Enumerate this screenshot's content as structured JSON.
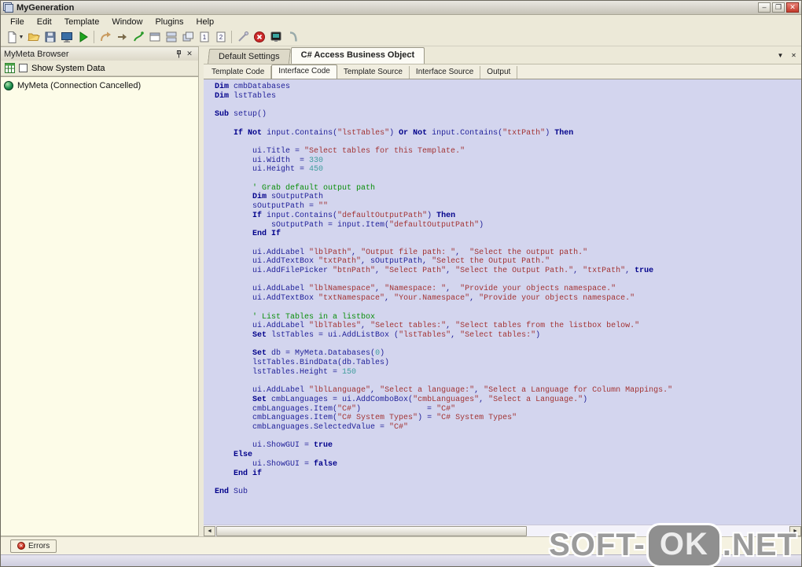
{
  "window": {
    "title": "MyGeneration",
    "controls": {
      "minimize": "–",
      "restore": "❐",
      "close": "✕"
    }
  },
  "menu": [
    "File",
    "Edit",
    "Template",
    "Window",
    "Plugins",
    "Help"
  ],
  "toolbar": [
    {
      "name": "new-template-button",
      "shape": "page-new",
      "dropdown": true
    },
    {
      "name": "open-button",
      "shape": "folder-open"
    },
    {
      "name": "save-button",
      "shape": "save"
    },
    {
      "name": "dos-console-button",
      "shape": "console-blue"
    },
    {
      "name": "execute-template-button",
      "shape": "play-green"
    },
    {
      "name": "separator",
      "shape": "sep"
    },
    {
      "name": "redo-arrow-button",
      "shape": "arrow-curve"
    },
    {
      "name": "forward-arrow-button",
      "shape": "arrow-small"
    },
    {
      "name": "run-script-button",
      "shape": "runner-green"
    },
    {
      "name": "window-frame-button",
      "shape": "window-gray"
    },
    {
      "name": "tile-windows-button",
      "shape": "tile-h"
    },
    {
      "name": "cascade-windows-button",
      "shape": "cascade"
    },
    {
      "name": "document-1-button",
      "shape": "doc-1"
    },
    {
      "name": "document-2-button",
      "shape": "doc-2"
    },
    {
      "name": "separator",
      "shape": "sep"
    },
    {
      "name": "connect-button",
      "shape": "wand-gray"
    },
    {
      "name": "stop-button",
      "shape": "stop-red"
    },
    {
      "name": "console-dark-button",
      "shape": "monitor-dark"
    },
    {
      "name": "refresh-button",
      "shape": "phone-gray"
    }
  ],
  "left_panel": {
    "title": "MyMeta Browser",
    "checkbox_label": "Show System Data",
    "checkbox_checked": false,
    "tree": [
      {
        "label": "MyMeta (Connection Cancelled)",
        "icon": "green-sphere"
      }
    ]
  },
  "doc_tabs": [
    {
      "label": "Default Settings",
      "active": false
    },
    {
      "label": "C# Access Business Object",
      "active": true
    }
  ],
  "doc_tab_buttons": {
    "dropdown": "▼",
    "close": "✕"
  },
  "view_tabs": [
    {
      "label": "Template Code",
      "active": false
    },
    {
      "label": "Interface Code",
      "active": true
    },
    {
      "label": "Template Source",
      "active": false
    },
    {
      "label": "Interface Source",
      "active": false
    },
    {
      "label": "Output",
      "active": false
    }
  ],
  "editor": {
    "bg_color": "#d3d5ee",
    "syntax_colors": {
      "keyword": "#00008b",
      "plain": "#22229a",
      "string": "#a33434",
      "comment": "#0a8f0a",
      "number": "#3f9d9d"
    },
    "lines": [
      [
        [
          "k",
          "Dim"
        ],
        [
          "p",
          " cmbDatabases"
        ]
      ],
      [
        [
          "k",
          "Dim"
        ],
        [
          "p",
          " lstTables"
        ]
      ],
      [],
      [
        [
          "k",
          "Sub"
        ],
        [
          "p",
          " setup()"
        ]
      ],
      [],
      [
        [
          "p",
          "    "
        ],
        [
          "k",
          "If"
        ],
        [
          "p",
          " "
        ],
        [
          "k",
          "Not"
        ],
        [
          "p",
          " input.Contains("
        ],
        [
          "s",
          "\"lstTables\""
        ],
        [
          "p",
          ") "
        ],
        [
          "k",
          "Or"
        ],
        [
          "p",
          " "
        ],
        [
          "k",
          "Not"
        ],
        [
          "p",
          " input.Contains("
        ],
        [
          "s",
          "\"txtPath\""
        ],
        [
          "p",
          ") "
        ],
        [
          "k",
          "Then"
        ]
      ],
      [],
      [
        [
          "p",
          "        ui.Title = "
        ],
        [
          "s",
          "\"Select tables for this Template.\""
        ]
      ],
      [
        [
          "p",
          "        ui.Width  = "
        ],
        [
          "n",
          "330"
        ]
      ],
      [
        [
          "p",
          "        ui.Height = "
        ],
        [
          "n",
          "450"
        ]
      ],
      [],
      [
        [
          "p",
          "        "
        ],
        [
          "c",
          "' Grab default output path"
        ]
      ],
      [
        [
          "p",
          "        "
        ],
        [
          "k",
          "Dim"
        ],
        [
          "p",
          " sOutputPath"
        ]
      ],
      [
        [
          "p",
          "        sOutputPath = "
        ],
        [
          "s",
          "\"\""
        ]
      ],
      [
        [
          "p",
          "        "
        ],
        [
          "k",
          "If"
        ],
        [
          "p",
          " input.Contains("
        ],
        [
          "s",
          "\"defaultOutputPath\""
        ],
        [
          "p",
          ") "
        ],
        [
          "k",
          "Then"
        ]
      ],
      [
        [
          "p",
          "            sOutputPath = input.Item("
        ],
        [
          "s",
          "\"defaultOutputPath\""
        ],
        [
          "p",
          ")"
        ]
      ],
      [
        [
          "p",
          "        "
        ],
        [
          "k",
          "End If"
        ]
      ],
      [],
      [
        [
          "p",
          "        ui.AddLabel "
        ],
        [
          "s",
          "\"lblPath\""
        ],
        [
          "p",
          ", "
        ],
        [
          "s",
          "\"Output file path: \""
        ],
        [
          "p",
          ",  "
        ],
        [
          "s",
          "\"Select the output path.\""
        ]
      ],
      [
        [
          "p",
          "        ui.AddTextBox "
        ],
        [
          "s",
          "\"txtPath\""
        ],
        [
          "p",
          ", sOutputPath, "
        ],
        [
          "s",
          "\"Select the Output Path.\""
        ]
      ],
      [
        [
          "p",
          "        ui.AddFilePicker "
        ],
        [
          "s",
          "\"btnPath\""
        ],
        [
          "p",
          ", "
        ],
        [
          "s",
          "\"Select Path\""
        ],
        [
          "p",
          ", "
        ],
        [
          "s",
          "\"Select the Output Path.\""
        ],
        [
          "p",
          ", "
        ],
        [
          "s",
          "\"txtPath\""
        ],
        [
          "p",
          ", "
        ],
        [
          "k",
          "true"
        ]
      ],
      [],
      [
        [
          "p",
          "        ui.AddLabel "
        ],
        [
          "s",
          "\"lblNamespace\""
        ],
        [
          "p",
          ", "
        ],
        [
          "s",
          "\"Namespace: \""
        ],
        [
          "p",
          ",  "
        ],
        [
          "s",
          "\"Provide your objects namespace.\""
        ]
      ],
      [
        [
          "p",
          "        ui.AddTextBox "
        ],
        [
          "s",
          "\"txtNamespace\""
        ],
        [
          "p",
          ", "
        ],
        [
          "s",
          "\"Your.Namespace\""
        ],
        [
          "p",
          ", "
        ],
        [
          "s",
          "\"Provide your objects namespace.\""
        ]
      ],
      [],
      [
        [
          "p",
          "        "
        ],
        [
          "c",
          "' List Tables in a listbox"
        ]
      ],
      [
        [
          "p",
          "        ui.AddLabel "
        ],
        [
          "s",
          "\"lblTables\""
        ],
        [
          "p",
          ", "
        ],
        [
          "s",
          "\"Select tables:\""
        ],
        [
          "p",
          ", "
        ],
        [
          "s",
          "\"Select tables from the listbox below.\""
        ]
      ],
      [
        [
          "p",
          "        "
        ],
        [
          "k",
          "Set"
        ],
        [
          "p",
          " lstTables = ui.AddListBox ("
        ],
        [
          "s",
          "\"lstTables\""
        ],
        [
          "p",
          ", "
        ],
        [
          "s",
          "\"Select tables:\""
        ],
        [
          "p",
          ")"
        ]
      ],
      [],
      [
        [
          "p",
          "        "
        ],
        [
          "k",
          "Set"
        ],
        [
          "p",
          " db = MyMeta.Databases("
        ],
        [
          "n",
          "0"
        ],
        [
          "p",
          ")"
        ]
      ],
      [
        [
          "p",
          "        lstTables.BindData(db.Tables)"
        ]
      ],
      [
        [
          "p",
          "        lstTables.Height = "
        ],
        [
          "n",
          "150"
        ]
      ],
      [],
      [
        [
          "p",
          "        ui.AddLabel "
        ],
        [
          "s",
          "\"lblLanguage\""
        ],
        [
          "p",
          ", "
        ],
        [
          "s",
          "\"Select a language:\""
        ],
        [
          "p",
          ", "
        ],
        [
          "s",
          "\"Select a Language for Column Mappings.\""
        ]
      ],
      [
        [
          "p",
          "        "
        ],
        [
          "k",
          "Set"
        ],
        [
          "p",
          " cmbLanguages = ui.AddComboBox("
        ],
        [
          "s",
          "\"cmbLanguages\""
        ],
        [
          "p",
          ", "
        ],
        [
          "s",
          "\"Select a Language.\""
        ],
        [
          "p",
          ")"
        ]
      ],
      [
        [
          "p",
          "        cmbLanguages.Item("
        ],
        [
          "s",
          "\"C#\""
        ],
        [
          "p",
          ")              = "
        ],
        [
          "s",
          "\"C#\""
        ]
      ],
      [
        [
          "p",
          "        cmbLanguages.Item("
        ],
        [
          "s",
          "\"C# System Types\""
        ],
        [
          "p",
          ") = "
        ],
        [
          "s",
          "\"C# System Types\""
        ]
      ],
      [
        [
          "p",
          "        cmbLanguages.SelectedValue = "
        ],
        [
          "s",
          "\"C#\""
        ]
      ],
      [],
      [
        [
          "p",
          "        ui.ShowGUI = "
        ],
        [
          "k",
          "true"
        ]
      ],
      [
        [
          "p",
          "    "
        ],
        [
          "k",
          "Else"
        ]
      ],
      [
        [
          "p",
          "        ui.ShowGUI = "
        ],
        [
          "k",
          "false"
        ]
      ],
      [
        [
          "p",
          "    "
        ],
        [
          "k",
          "End if"
        ]
      ],
      [],
      [
        [
          "k",
          "End"
        ],
        [
          "p",
          " Sub"
        ]
      ]
    ]
  },
  "scrollbar": {
    "left_arrow": "◄",
    "right_arrow": "►",
    "thumb_percent": 52
  },
  "errors_panel": {
    "label": "Errors"
  },
  "watermark": {
    "part1": "SOFT-",
    "part2": "OK",
    "part3": ".NET"
  }
}
